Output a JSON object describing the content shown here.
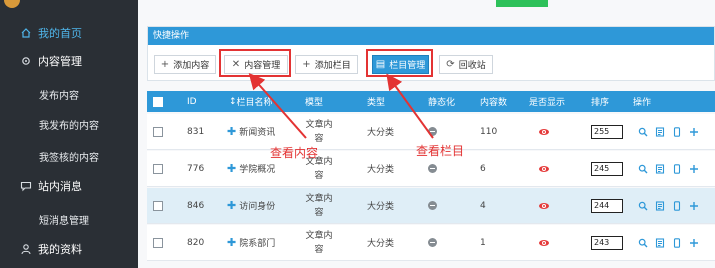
{
  "sidebar": {
    "items": [
      {
        "label": "我的首页",
        "icon": "home-icon",
        "active": true
      },
      {
        "label": "内容管理",
        "icon": "gear-icon"
      },
      {
        "label": "发布内容",
        "sub": true
      },
      {
        "label": "我发布的内容",
        "sub": true
      },
      {
        "label": "我签核的内容",
        "sub": true
      },
      {
        "label": "站内消息",
        "icon": "message-icon"
      },
      {
        "label": "短消息管理",
        "sub": true
      },
      {
        "label": "我的资料",
        "icon": "user-icon"
      }
    ]
  },
  "quick_actions": {
    "title": "快捷操作",
    "buttons": [
      {
        "label": "添加内容",
        "icon": "plus-icon"
      },
      {
        "label": "内容管理",
        "icon": "shuffle-icon"
      },
      {
        "label": "添加栏目",
        "icon": "plus-icon"
      },
      {
        "label": "栏目管理",
        "icon": "list-icon"
      },
      {
        "label": "回收站",
        "icon": "recycle-icon"
      }
    ]
  },
  "table": {
    "headers": [
      "",
      "ID",
      "栏目名称",
      "模型",
      "类型",
      "静态化",
      "内容数",
      "是否显示",
      "排序",
      "操作"
    ],
    "rows": [
      {
        "id": "831",
        "name": "新闻资讯",
        "model": "文章内容",
        "type": "大分类",
        "count": "110",
        "sort": "255"
      },
      {
        "id": "776",
        "name": "学院概况",
        "model": "文章内容",
        "type": "大分类",
        "count": "6",
        "sort": "245"
      },
      {
        "id": "846",
        "name": "访问身份",
        "model": "文章内容",
        "type": "大分类",
        "count": "4",
        "sort": "244"
      },
      {
        "id": "820",
        "name": "院系部门",
        "model": "文章内容",
        "type": "大分类",
        "count": "1",
        "sort": "243"
      }
    ]
  },
  "annotations": {
    "content_label": "查看内容",
    "column_label": "查看栏目",
    "color": "#e33333"
  },
  "colors": {
    "sidebar_bg": "#2a2f35",
    "accent": "#2e98d8",
    "active_text": "#4fb5ea",
    "highlight_row": "#dfeef7"
  }
}
